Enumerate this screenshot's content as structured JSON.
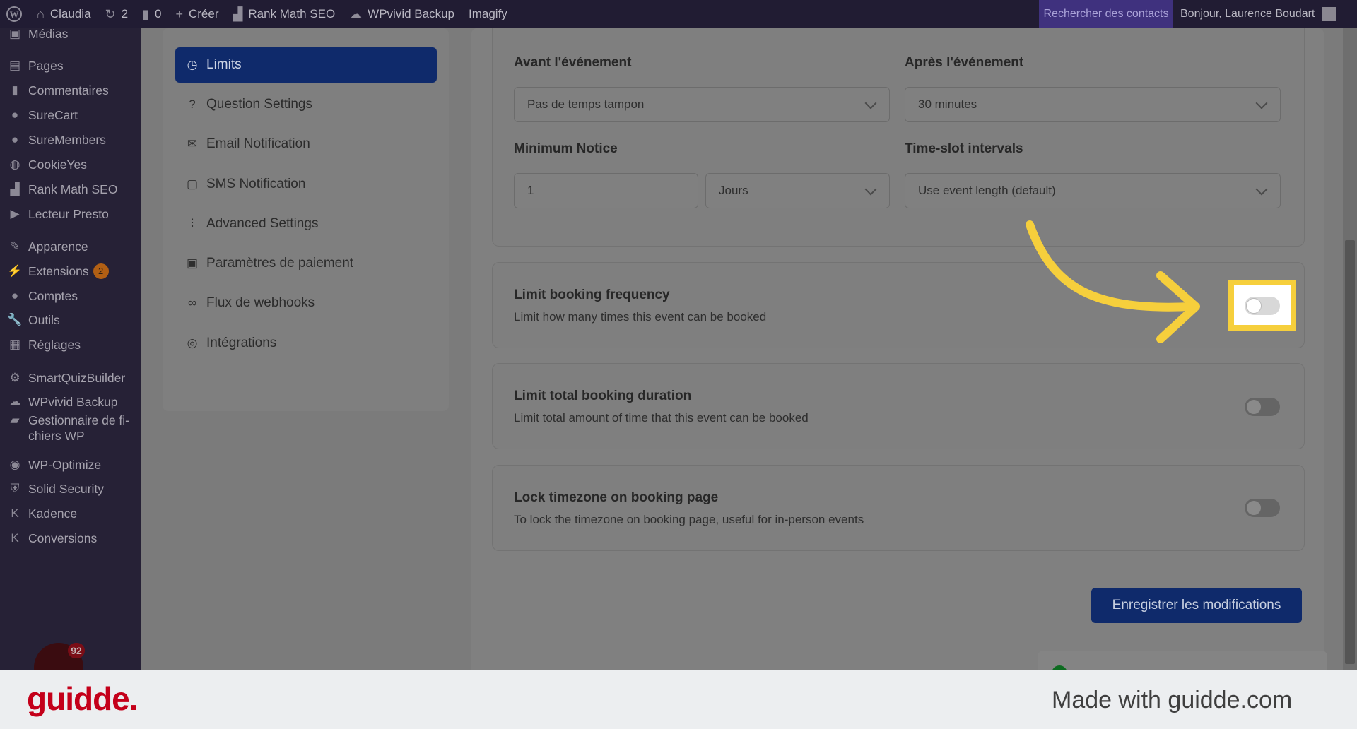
{
  "admin_bar": {
    "site": "Claudia",
    "updates": "2",
    "comments": "0",
    "create": "Créer",
    "rank_math": "Rank Math SEO",
    "wpvivid": "WPvivid Backup",
    "imagify": "Imagify",
    "search_contacts": "Rechercher des contacts",
    "greeting": "Bonjour, Laurence Boudart"
  },
  "sidebar": {
    "items": [
      {
        "label": "Médias",
        "icon": "media-icon"
      },
      {
        "label": "Pages",
        "icon": "pages-icon"
      },
      {
        "label": "Commentaires",
        "icon": "comments-icon"
      },
      {
        "label": "SureCart",
        "icon": "surecart-icon"
      },
      {
        "label": "SureMembers",
        "icon": "suremembers-icon"
      },
      {
        "label": "CookieYes",
        "icon": "cookie-icon"
      },
      {
        "label": "Rank Math SEO",
        "icon": "rankmath-icon"
      },
      {
        "label": "Lecteur Presto",
        "icon": "presto-icon"
      },
      {
        "label": "Apparence",
        "icon": "brush-icon"
      },
      {
        "label": "Extensions",
        "icon": "plugin-icon",
        "badge": "2"
      },
      {
        "label": "Comptes",
        "icon": "user-icon"
      },
      {
        "label": "Outils",
        "icon": "wrench-icon"
      },
      {
        "label": "Réglages",
        "icon": "settings-icon"
      },
      {
        "label": "SmartQuizBuilder",
        "icon": "gear-icon"
      },
      {
        "label": "WPvivid Backup",
        "icon": "cloud-icon"
      },
      {
        "label": "Gestionnaire de fi-",
        "label2": "chiers WP",
        "icon": "folder-icon"
      },
      {
        "label": "WP-Optimize",
        "icon": "optimize-icon"
      },
      {
        "label": "Solid Security",
        "icon": "shield-icon"
      },
      {
        "label": "Kadence",
        "icon": "kadence-icon"
      },
      {
        "label": "Conversions",
        "icon": "conversions-icon"
      }
    ],
    "widget_badge": "92"
  },
  "settings_nav": {
    "items": [
      {
        "label": "Limits",
        "icon": "clock-icon",
        "active": true
      },
      {
        "label": "Question Settings",
        "icon": "question-icon"
      },
      {
        "label": "Email Notification",
        "icon": "mail-icon"
      },
      {
        "label": "SMS Notification",
        "icon": "sms-icon"
      },
      {
        "label": "Advanced Settings",
        "icon": "sliders-icon"
      },
      {
        "label": "Paramètres de paiement",
        "icon": "payment-icon"
      },
      {
        "label": "Flux de webhooks",
        "icon": "link-icon"
      },
      {
        "label": "Intégrations",
        "icon": "integrations-icon"
      }
    ]
  },
  "limits": {
    "before_label": "Avant l'événement",
    "before_value": "Pas de temps tampon",
    "after_label": "Après l'événement",
    "after_value": "30 minutes",
    "min_notice_label": "Minimum Notice",
    "min_notice_value": "1",
    "min_notice_unit": "Jours",
    "timeslot_label": "Time-slot intervals",
    "timeslot_value": "Use event length (default)"
  },
  "sections": [
    {
      "title": "Limit booking frequency",
      "desc": "Limit how many times this event can be booked",
      "enabled": false
    },
    {
      "title": "Limit total booking duration",
      "desc": "Limit total amount of time that this event can be booked",
      "enabled": false
    },
    {
      "title": "Lock timezone on booking page",
      "desc": "To lock the timezone on booking page, useful for in-person events",
      "enabled": false
    }
  ],
  "save_label": "Enregistrer les modifications",
  "footer": {
    "brand": "guidde.",
    "made_with": "Made with guidde.com"
  },
  "colors": {
    "accent": "#0f2a6b",
    "highlight": "#f6cf3c",
    "brand": "#c4001a"
  }
}
